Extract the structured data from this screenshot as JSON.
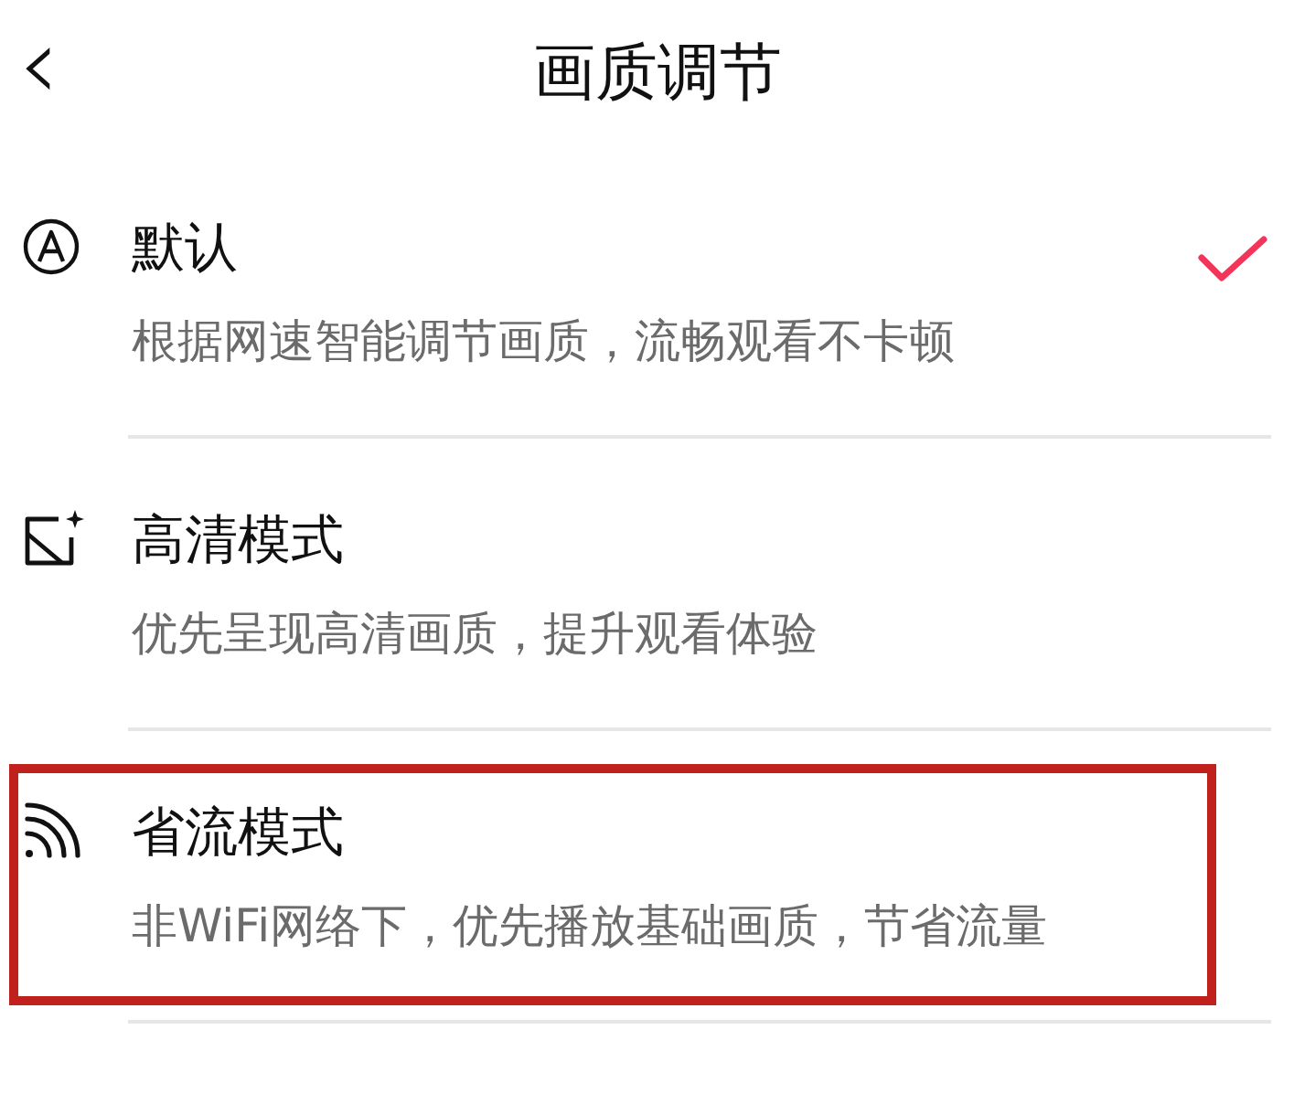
{
  "header": {
    "back": "‹",
    "title": "画质调节"
  },
  "options": [
    {
      "kind": "auto",
      "title": "默认",
      "description": "根据网速智能调节画质，流畅观看不卡顿",
      "selected": true,
      "highlighted": false
    },
    {
      "kind": "hd",
      "title": "高清模式",
      "description": "优先呈现高清画质，提升观看体验",
      "selected": false,
      "highlighted": false
    },
    {
      "kind": "saver",
      "title": "省流模式",
      "description": "非WiFi网络下，优先播放基础画质，节省流量",
      "selected": false,
      "highlighted": true
    }
  ]
}
